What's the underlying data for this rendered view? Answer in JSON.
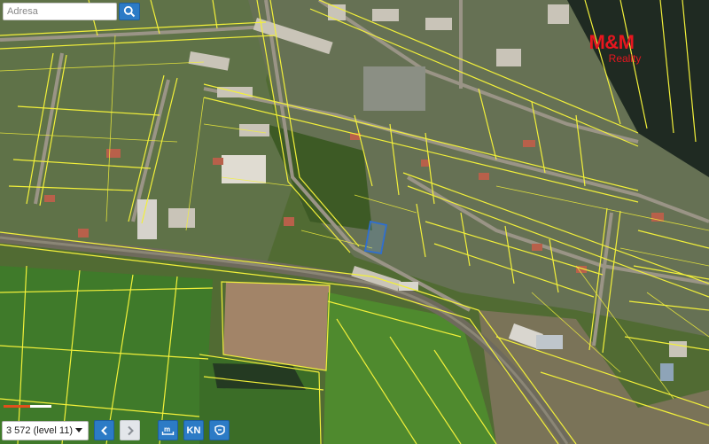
{
  "search": {
    "placeholder": "Adresa"
  },
  "logo": {
    "main": "M&M",
    "sub": "Reality"
  },
  "zoom": {
    "label": "3 572 (level 11)"
  },
  "tools": {
    "kn_label": "KN"
  },
  "icons": [
    "search-icon",
    "chevron-left-icon",
    "chevron-right-icon",
    "measure-icon",
    "kn-icon",
    "parcel-info-icon"
  ],
  "colors": {
    "parcel_lines": "#f2f03a",
    "selected_parcel": "#2f6fd0",
    "button_blue": "#2c7bc6",
    "logo_red": "#e8161f",
    "scalebar_orange": "#e0501c"
  }
}
